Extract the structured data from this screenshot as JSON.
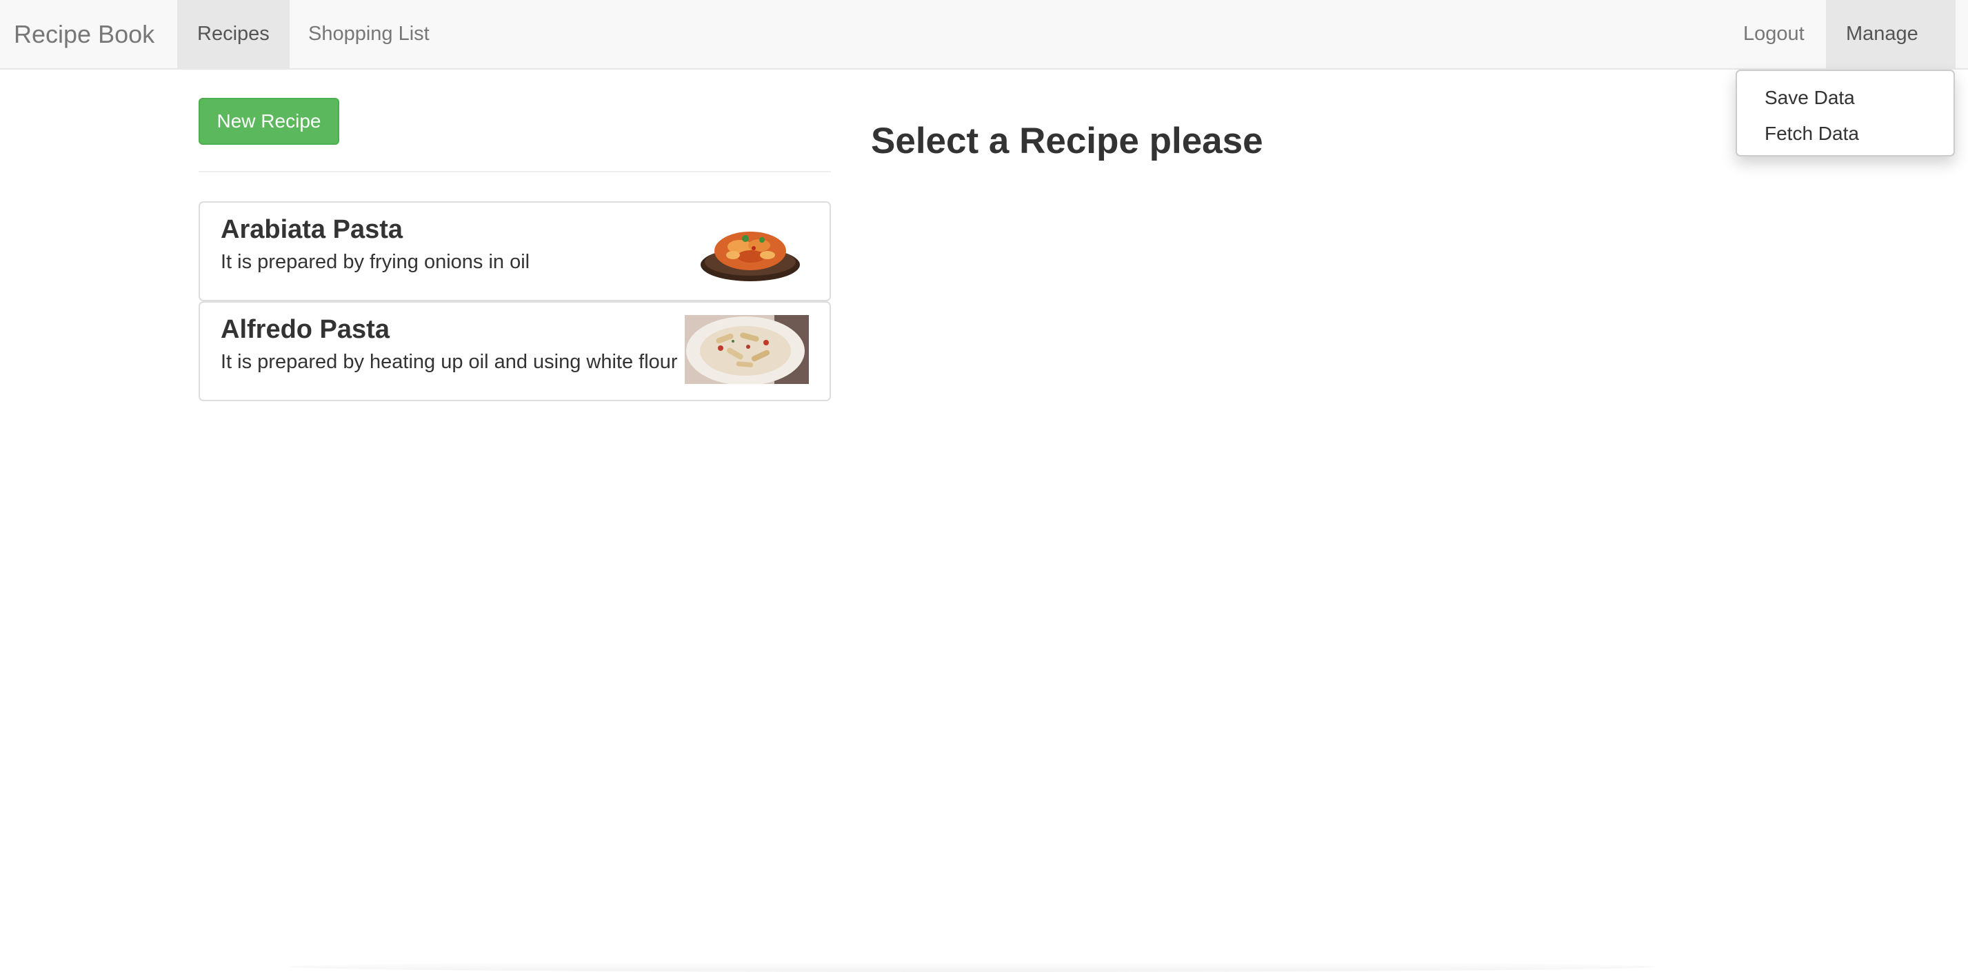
{
  "navbar": {
    "brand": "Recipe Book",
    "links": {
      "recipes": "Recipes",
      "shopping_list": "Shopping List"
    },
    "logout": "Logout",
    "manage": "Manage",
    "dropdown": {
      "save": "Save Data",
      "fetch": "Fetch Data"
    }
  },
  "recipes_panel": {
    "new_recipe_label": "New Recipe",
    "items": [
      {
        "name": "Arabiata Pasta",
        "description": "It is prepared by frying onions in oil",
        "image_icon": "pasta-dish-icon"
      },
      {
        "name": "Alfredo Pasta",
        "description": "It is prepared by heating up oil and using white flour",
        "image_icon": "pasta-plate-icon"
      }
    ]
  },
  "detail": {
    "heading": "Select a Recipe please"
  },
  "colors": {
    "navbar_bg": "#f8f8f8",
    "active_tab_bg": "#e7e7e7",
    "success": "#5cb85c"
  }
}
